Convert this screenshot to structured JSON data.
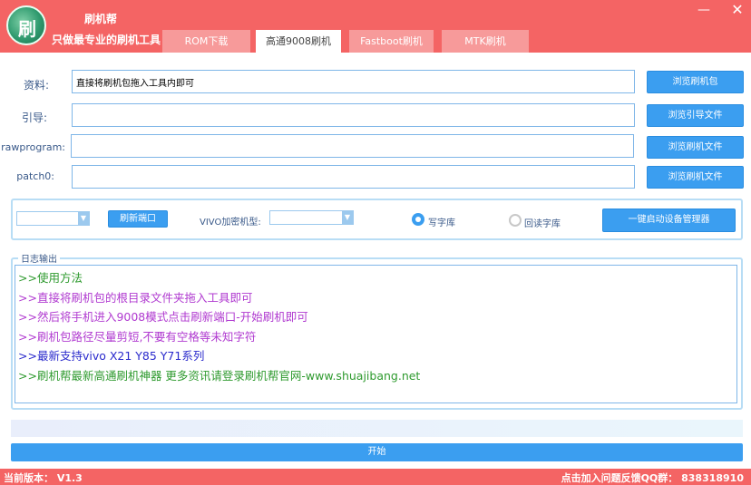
{
  "app": {
    "name": "刷机帮",
    "slogan": "只做最专业的刷机工具",
    "logo_glyph": "刷"
  },
  "window": {
    "minimize": "—",
    "close": "✕"
  },
  "tabs": [
    {
      "label": "ROM下载",
      "active": false
    },
    {
      "label": "高通9008刷机",
      "active": true
    },
    {
      "label": "Fastboot刷机",
      "active": false
    },
    {
      "label": "MTK刷机",
      "active": false
    }
  ],
  "rows": [
    {
      "label": "资料:",
      "value": "直接将刷机包拖入工具内即可",
      "button": "浏览刷机包"
    },
    {
      "label": "引导:",
      "value": "",
      "button": "浏览引导文件"
    },
    {
      "label": "rawprogram:",
      "value": "",
      "button": "浏览刷机文件"
    },
    {
      "label": "patch0:",
      "value": "",
      "button": "浏览刷机文件"
    }
  ],
  "options": {
    "port_combo_value": "",
    "refresh_port": "刷新端口",
    "vivo_label": "VIVO加密机型:",
    "vivo_combo_value": "",
    "radio_write": {
      "label": "写字库",
      "checked": true
    },
    "radio_read": {
      "label": "回读字库",
      "checked": false
    },
    "device_manager": "一键启动设备管理器"
  },
  "log": {
    "title": "日志输出",
    "lines": [
      {
        "text": ">>使用方法",
        "color": "#2e9a2e"
      },
      {
        "text": ">>直接将刷机包的根目录文件夹拖入工具即可",
        "color": "#b03ad0"
      },
      {
        "text": ">>然后将手机进入9008模式点击刷新端口-开始刷机即可",
        "color": "#b03ad0"
      },
      {
        "text": ">>刷机包路径尽量剪短,不要有空格等未知字符",
        "color": "#b03ad0"
      },
      {
        "text": ">>最新支持vivo X21 Y85 Y71系列",
        "color": "#2a2acc"
      },
      {
        "text": ">>刷机帮最新高通刷机神器 更多资讯请登录刷机帮官网-www.shuajibang.net",
        "color": "#2e9a2e"
      }
    ]
  },
  "progress": {
    "value": 0
  },
  "start_button": "开始",
  "footer": {
    "version": "当前版本：  V1.3",
    "feedback": "点击加入问题反馈QQ群： 838318910"
  },
  "colors": {
    "brand_red": "#f46464",
    "accent_blue": "#3b9ef0"
  }
}
